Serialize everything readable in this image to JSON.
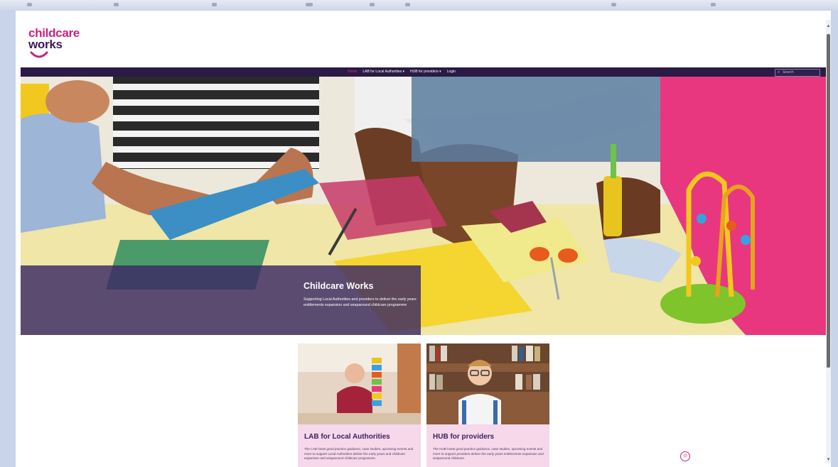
{
  "header": {
    "logo_line1": "childcare",
    "logo_line2": "works"
  },
  "nav": {
    "items": [
      {
        "label": "Home",
        "active": true
      },
      {
        "label": "LAB for Local Authorities ▾",
        "active": false
      },
      {
        "label": "HUB for providers ▾",
        "active": false
      },
      {
        "label": "Login",
        "active": false
      }
    ],
    "search_placeholder": "Search"
  },
  "hero": {
    "title": "Childcare Works",
    "subtitle": "Supporting Local Authorities and providers to deliver the early years entitlements expansion and wraparound childcare programme"
  },
  "cards": [
    {
      "title": "LAB for Local Authorities",
      "text": "The LAB hosts good practice guidance, case studies, upcoming events and more to support Local Authorities deliver the early years and childcare expansion and wraparound childcare programme."
    },
    {
      "title": "HUB for providers",
      "text": "The HUB hosts good practice guidance, case studies, upcoming events and more to support providers deliver the early years entitlements expansion and wraparound childcare."
    }
  ],
  "colors": {
    "brand_pink": "#d01f7f",
    "brand_purple": "#3a1b5e",
    "navbar": "#2a1a45",
    "card_bg": "#f6d8ea"
  },
  "icons": {
    "search": "search-icon",
    "chat": "chat-icon"
  }
}
